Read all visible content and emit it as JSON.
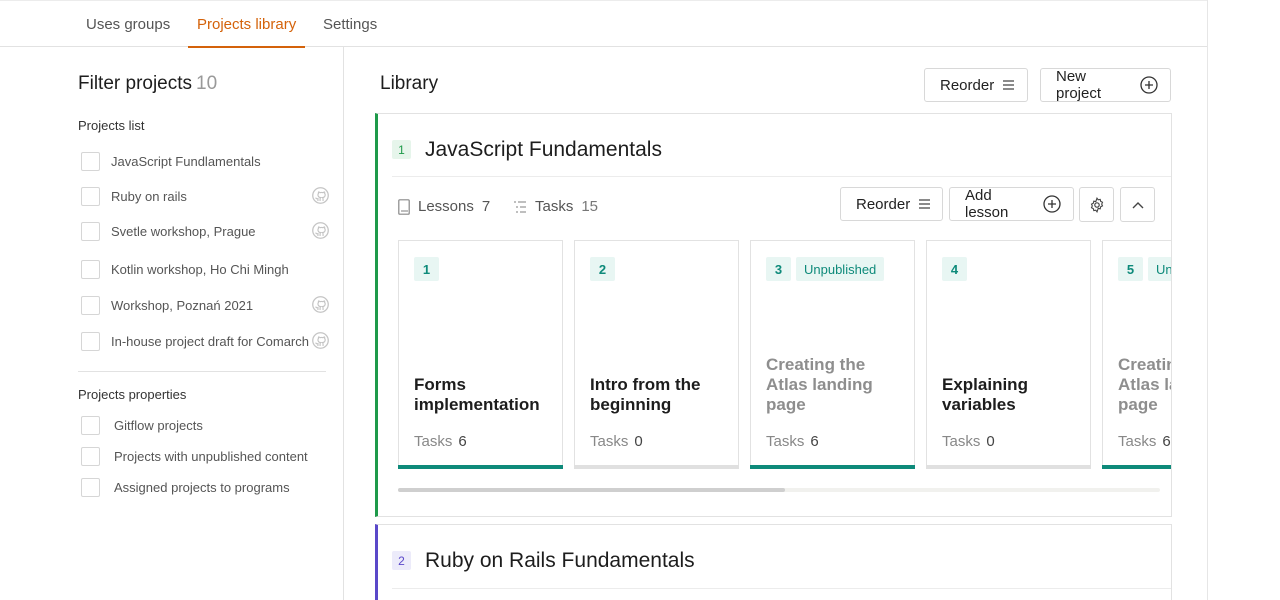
{
  "tabs": [
    {
      "label": "Uses groups"
    },
    {
      "label": "Projects library"
    },
    {
      "label": "Settings"
    }
  ],
  "sidebar": {
    "title": "Filter projects",
    "count": "10",
    "projects_list_label": "Projects list",
    "projects": [
      {
        "label": "JavaScript Fundlamentals",
        "github": false
      },
      {
        "label": "Ruby on rails",
        "github": true
      },
      {
        "label": "Svetle workshop, Prague",
        "github": true
      },
      {
        "label": "Kotlin workshop, Ho Chi Mingh",
        "github": false
      },
      {
        "label": "Workshop, Poznań 2021",
        "github": true
      },
      {
        "label": "In-house project draft for Comarch",
        "github": true
      }
    ],
    "properties_label": "Projects properties",
    "properties": [
      {
        "label": "Gitflow projects"
      },
      {
        "label": "Projects with unpublished content"
      },
      {
        "label": "Assigned projects to programs"
      }
    ]
  },
  "main": {
    "title": "Library",
    "reorder_label": "Reorder",
    "new_project_label": "New project",
    "projects": [
      {
        "number": "1",
        "title": "JavaScript Fundamentals",
        "lessons_label": "Lessons",
        "lessons_count": "7",
        "tasks_label": "Tasks",
        "tasks_count": "15",
        "reorder_label": "Reorder",
        "add_lesson_label": "Add lesson",
        "lessons": [
          {
            "number": "1",
            "badge": "",
            "title": "Forms implementation",
            "tasks_label": "Tasks",
            "tasks": "6",
            "published": true
          },
          {
            "number": "2",
            "badge": "",
            "title": "Intro from the beginning",
            "tasks_label": "Tasks",
            "tasks": "0",
            "published": true
          },
          {
            "number": "3",
            "badge": "Unpublished",
            "title": "Creating the Atlas landing page",
            "tasks_label": "Tasks",
            "tasks": "6",
            "published": false
          },
          {
            "number": "4",
            "badge": "",
            "title": "Explaining variables",
            "tasks_label": "Tasks",
            "tasks": "0",
            "published": true
          },
          {
            "number": "5",
            "badge": "Unpublished",
            "title": "Creating the Atlas landing page",
            "tasks_label": "Tasks",
            "tasks": "6",
            "published": false
          }
        ]
      },
      {
        "number": "2",
        "title": "Ruby on Rails Fundamentals"
      }
    ]
  },
  "colors": {
    "accent": "#d4620a",
    "project1_border": "#1e9a4a",
    "project2_border": "#5a48c9",
    "lesson_accent": "#0e8a7a"
  }
}
